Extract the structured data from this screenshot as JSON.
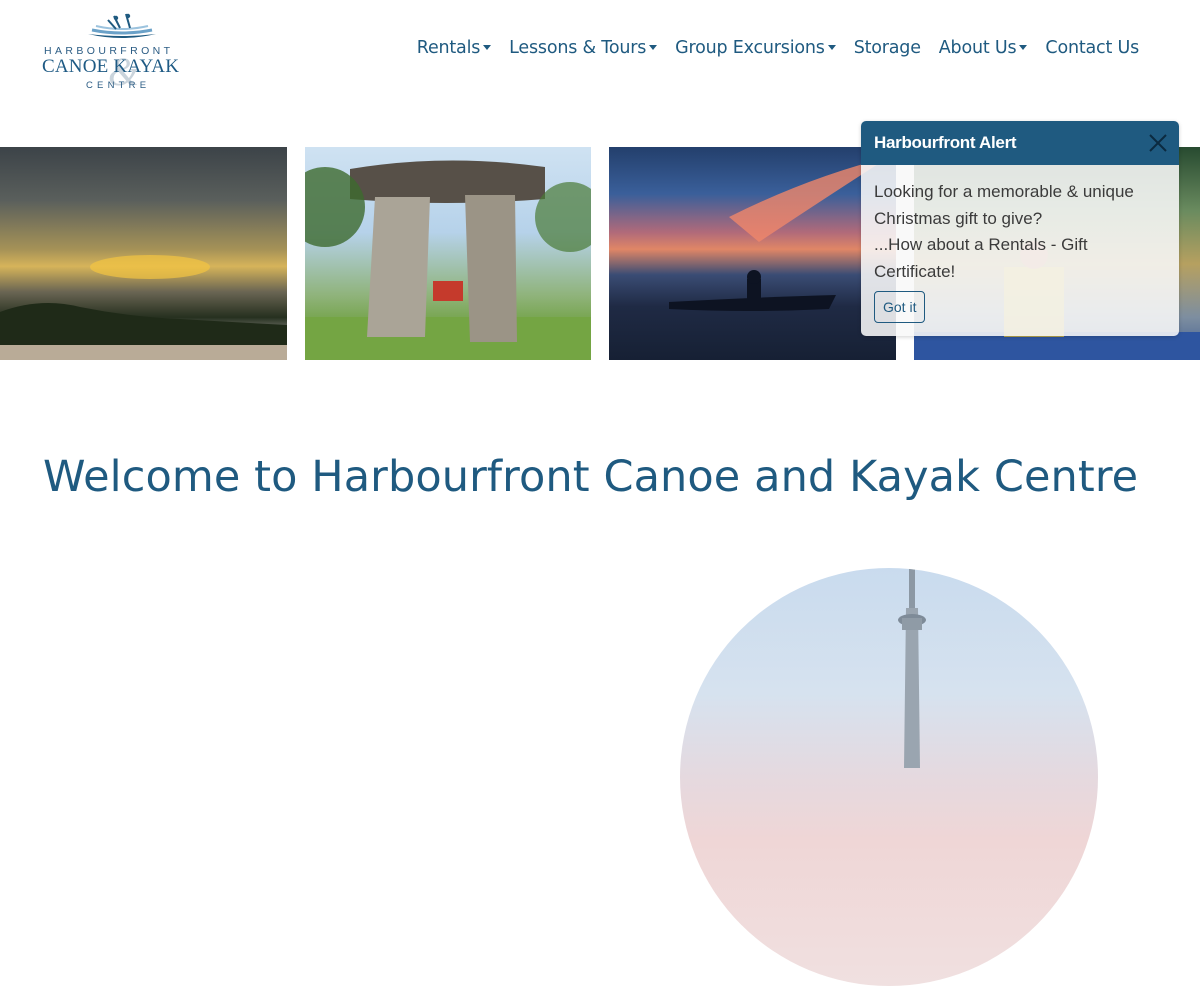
{
  "logo": {
    "line1": "HARBOURFRONT",
    "line2": "CANOE    KAYAK",
    "amp": "&",
    "line3": "CENTRE"
  },
  "nav": {
    "items": [
      {
        "label": "Rentals",
        "dropdown": true
      },
      {
        "label": "Lessons & Tours",
        "dropdown": true
      },
      {
        "label": "Group Excursions",
        "dropdown": true
      },
      {
        "label": "Storage",
        "dropdown": false
      },
      {
        "label": "About Us",
        "dropdown": true
      },
      {
        "label": "Contact Us",
        "dropdown": false
      }
    ]
  },
  "alert": {
    "title": "Harbourfront Alert",
    "line1": "Looking for a memorable & unique Christmas gift to give?",
    "line2": "...How about a Rentals - Gift Certificate!",
    "button": "Got it"
  },
  "main": {
    "heading": "Welcome to Harbourfront Canoe and Kayak Centre"
  },
  "colors": {
    "brand": "#1f5a80",
    "background": "#ffffff"
  }
}
